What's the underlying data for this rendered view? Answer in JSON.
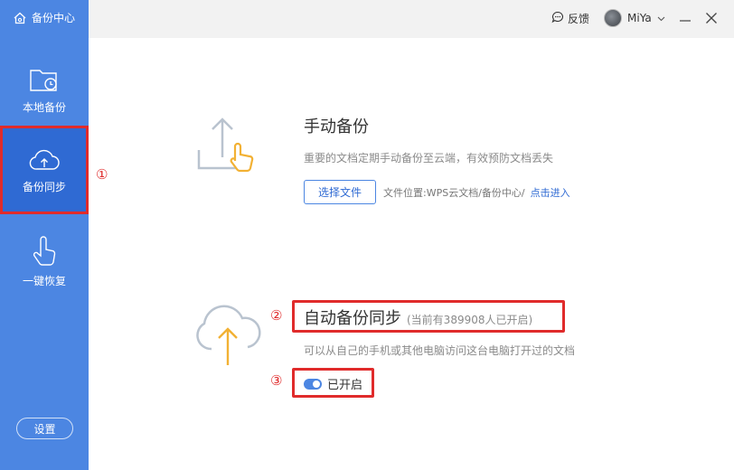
{
  "app": {
    "title": "备份中心"
  },
  "sidebar": {
    "items": [
      {
        "label": "本地备份",
        "icon": "folder-clock-icon",
        "active": false
      },
      {
        "label": "备份同步",
        "icon": "cloud-upload-icon",
        "active": true
      },
      {
        "label": "一键恢复",
        "icon": "hand-pointer-icon",
        "active": false
      }
    ],
    "settings_label": "设置"
  },
  "header": {
    "feedback_label": "反馈",
    "user_name": "MiYa"
  },
  "manual": {
    "title": "手动备份",
    "description": "重要的文档定期手动备份至云端，有效预防文档丢失",
    "choose_button": "选择文件",
    "location_label": "文件位置:WPS云文档/备份中心/",
    "location_link": "点击进入"
  },
  "auto": {
    "title": "自动备份同步",
    "subtitle": "(当前有389908人已开启)",
    "description": "可以从自己的手机或其他电脑访问这台电脑打开过的文档",
    "toggle_label": "已开启",
    "toggle_on": true
  },
  "markers": {
    "m1": "①",
    "m2": "②",
    "m3": "③"
  },
  "colors": {
    "sidebar": "#4c86e2",
    "sidebar_active": "#2f6ad3",
    "highlight": "#e02b2b",
    "accent_orange": "#f2b134"
  }
}
